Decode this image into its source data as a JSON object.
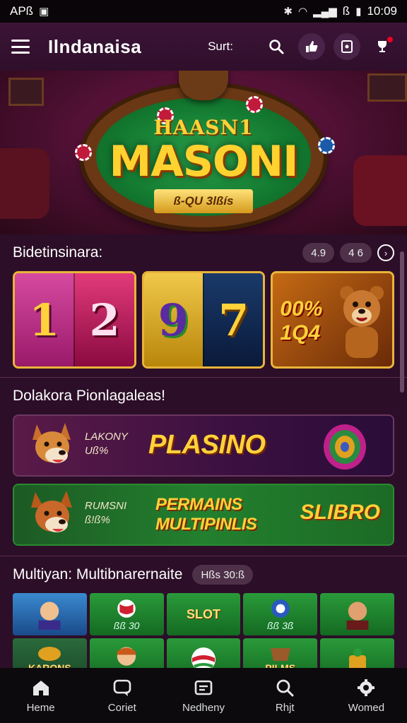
{
  "status_bar": {
    "carrier": "APß",
    "time": "10:09",
    "right_text": "ß"
  },
  "header": {
    "title": "Ilndanaisa",
    "sort_label": "Surt:"
  },
  "hero": {
    "small_text": "HAASN1",
    "big_text": "MASONI",
    "ribbon_text": "ß-QU 3lßís"
  },
  "section1": {
    "title": "Bidetinsinara:",
    "pill1": "4.9",
    "pill2": "4 6",
    "cards": [
      {
        "reels": [
          "1",
          "2"
        ]
      },
      {
        "reels": [
          "9",
          "7"
        ]
      },
      {
        "line1": "00%",
        "line2": "1Q4"
      }
    ]
  },
  "section2": {
    "title": "Dolakora Pionlagaleas!",
    "banners": [
      {
        "side_line1": "LAKONY",
        "side_line2": "Uß%",
        "word": "PLASINO"
      },
      {
        "side_line1": "RUMSNI",
        "side_line2": "ß!ß%",
        "word_line1": "PERMAINS",
        "word_line2": "MULTIPINLIS",
        "logo": "SLIBRO"
      }
    ]
  },
  "section3": {
    "title": "Multiyan: Multibnarernaite",
    "pill": "Hßs 30:ß",
    "tiles": [
      {
        "label": "",
        "word": ""
      },
      {
        "label": "ßß 30",
        "word": ""
      },
      {
        "label": "",
        "word": "SLOT"
      },
      {
        "label": "ßß 3ß",
        "word": ""
      },
      {
        "label": "",
        "word": ""
      },
      {
        "label": "",
        "word": "KARONS"
      },
      {
        "label": "",
        "word": ""
      },
      {
        "label": "",
        "word": ""
      },
      {
        "label": "",
        "word": "PILMS"
      },
      {
        "label": "",
        "word": ""
      }
    ]
  },
  "bottom_nav": [
    {
      "label": "Heme",
      "icon": "home-icon"
    },
    {
      "label": "Coriet",
      "icon": "chat-icon"
    },
    {
      "label": "Nedheny",
      "icon": "wallet-icon"
    },
    {
      "label": "Rhjt",
      "icon": "search-icon"
    },
    {
      "label": "Womed",
      "icon": "settings-icon"
    }
  ],
  "colors": {
    "background": "#2c0e28",
    "accent_gold": "#ffd23a",
    "appbar": "#3c1436"
  }
}
